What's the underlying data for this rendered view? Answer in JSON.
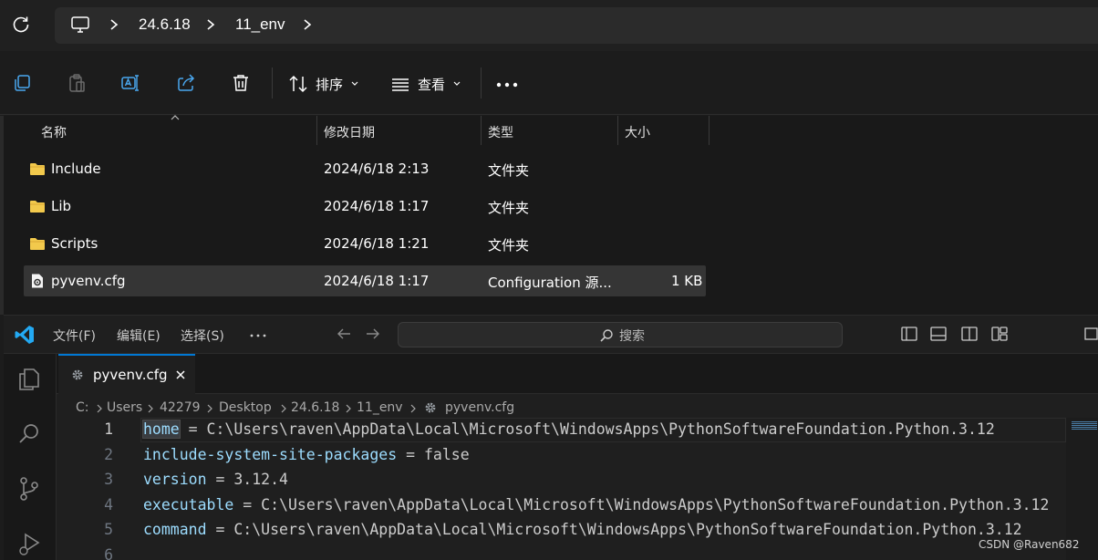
{
  "explorer": {
    "breadcrumb": [
      "24.6.18",
      "11_env"
    ],
    "toolbar": {
      "sort_label": "排序",
      "view_label": "查看"
    },
    "columns": {
      "name": "名称",
      "modified": "修改日期",
      "type": "类型",
      "size": "大小"
    },
    "files": [
      {
        "name": "Include",
        "modified": "2024/6/18 2:13",
        "type": "文件夹",
        "size": "",
        "icon": "folder-icon"
      },
      {
        "name": "Lib",
        "modified": "2024/6/18 1:17",
        "type": "文件夹",
        "size": "",
        "icon": "folder-icon"
      },
      {
        "name": "Scripts",
        "modified": "2024/6/18 1:21",
        "type": "文件夹",
        "size": "",
        "icon": "folder-icon"
      },
      {
        "name": "pyvenv.cfg",
        "modified": "2024/6/18 1:17",
        "type": "Configuration 源...",
        "size": "1 KB",
        "icon": "config-file-icon",
        "selected": true
      }
    ]
  },
  "vscode": {
    "menu": [
      "文件(F)",
      "编辑(E)",
      "选择(S)"
    ],
    "search_placeholder": "搜索",
    "tab_title": "pyvenv.cfg",
    "breadcrumb": [
      "C:",
      "Users",
      "42279",
      "Desktop",
      "24.6.18",
      "11_env",
      "pyvenv.cfg"
    ],
    "lines": [
      {
        "num": "1",
        "key": "home",
        "rest": " = C:\\Users\\raven\\AppData\\Local\\Microsoft\\WindowsApps\\PythonSoftwareFoundation.Python.3.12"
      },
      {
        "num": "2",
        "key": "include-system-site-packages",
        "rest": " = false"
      },
      {
        "num": "3",
        "key": "version",
        "rest": " = 3.12.4"
      },
      {
        "num": "4",
        "key": "executable",
        "rest": " = C:\\Users\\raven\\AppData\\Local\\Microsoft\\WindowsApps\\PythonSoftwareFoundation.Python.3.12"
      },
      {
        "num": "5",
        "key": "command",
        "rest": " = C:\\Users\\raven\\AppData\\Local\\Microsoft\\WindowsApps\\PythonSoftwareFoundation.Python.3.12"
      },
      {
        "num": "6",
        "key": "",
        "rest": ""
      }
    ]
  },
  "watermark": "CSDN @Raven682",
  "colors": {
    "accent": "#0078d4",
    "folder": "#f2c94c",
    "vscode_blue": "#23a9f2",
    "code_key": "#9cdcfe"
  }
}
